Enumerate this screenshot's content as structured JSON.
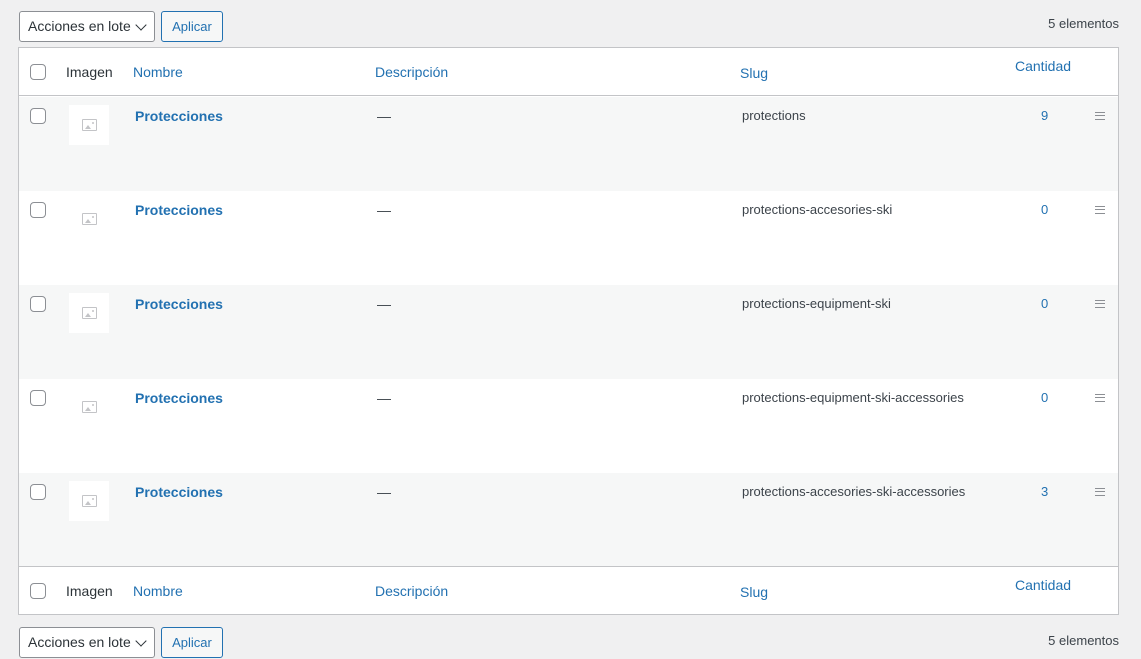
{
  "top_nav": {
    "bulk_actions": "Acciones en lote",
    "apply": "Aplicar",
    "count": "5 elementos"
  },
  "bottom_nav": {
    "bulk_actions": "Acciones en lote",
    "apply": "Aplicar",
    "count": "5 elementos"
  },
  "columns": {
    "image": "Imagen",
    "name": "Nombre",
    "description": "Descripción",
    "slug": "Slug",
    "count": "Cantidad"
  },
  "rows": [
    {
      "name": "Protecciones",
      "description": "—",
      "slug": "protections",
      "count": "9"
    },
    {
      "name": "Protecciones",
      "description": "—",
      "slug": "protections-accesories-ski",
      "count": "0"
    },
    {
      "name": "Protecciones",
      "description": "—",
      "slug": "protections-equipment-ski",
      "count": "0"
    },
    {
      "name": "Protecciones",
      "description": "—",
      "slug": "protections-equipment-ski-accessories",
      "count": "0"
    },
    {
      "name": "Protecciones",
      "description": "—",
      "slug": "protections-accesories-ski-accessories",
      "count": "3"
    }
  ],
  "icons": {
    "thumbnail": "image-placeholder-icon",
    "drag": "drag-handle-icon",
    "dropdown": "chevron-down-icon"
  },
  "colors": {
    "link": "#2271b1",
    "background": "#f0f0f1",
    "row_alt": "#f6f7f7",
    "border": "#c3c4c7"
  }
}
